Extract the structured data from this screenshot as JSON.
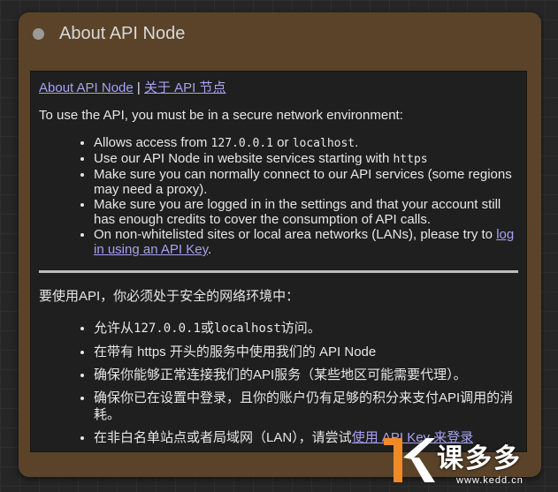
{
  "node": {
    "title": "About API Node"
  },
  "links": {
    "english": "About API Node",
    "separator": "|",
    "chinese": "关于 API 节点"
  },
  "english": {
    "intro": "To use the API, you must be in a secure network environment:",
    "b1_pre": "Allows access from ",
    "b1_code1": "127.0.0.1",
    "b1_mid": " or ",
    "b1_code2": "localhost",
    "b1_post": ".",
    "b2_pre": "Use our API Node in website services starting with ",
    "b2_code": "https",
    "b3": "Make sure you can normally connect to our API services (some regions may need a proxy).",
    "b4": "Make sure you are logged in in the settings and that your account still has enough credits to cover the consumption of API calls.",
    "b5_pre": "On non-whitelisted sites or local area networks (LANs), please try to ",
    "b5_link": "log in using an API Key",
    "b5_post": "."
  },
  "chinese": {
    "intro": "要使用API，你必须处于安全的网络环境中：",
    "b1_pre": "允许从",
    "b1_code1": "127.0.0.1",
    "b1_mid": "或",
    "b1_code2": "localhost",
    "b1_post": "访问。",
    "b2": "在带有 https 开头的服务中使用我们的 API Node",
    "b3": "确保你能够正常连接我们的API服务（某些地区可能需要代理）。",
    "b4": "确保你已在设置中登录，且你的账户仍有足够的积分来支付API调用的消耗。",
    "b5_pre": "在非白名单站点或者局域网（LAN），请尝试",
    "b5_link": "使用 API Key 来登录"
  },
  "watermark": {
    "text": "课多多",
    "url": "www.kedd.cn",
    "accent": "#f08a24"
  }
}
